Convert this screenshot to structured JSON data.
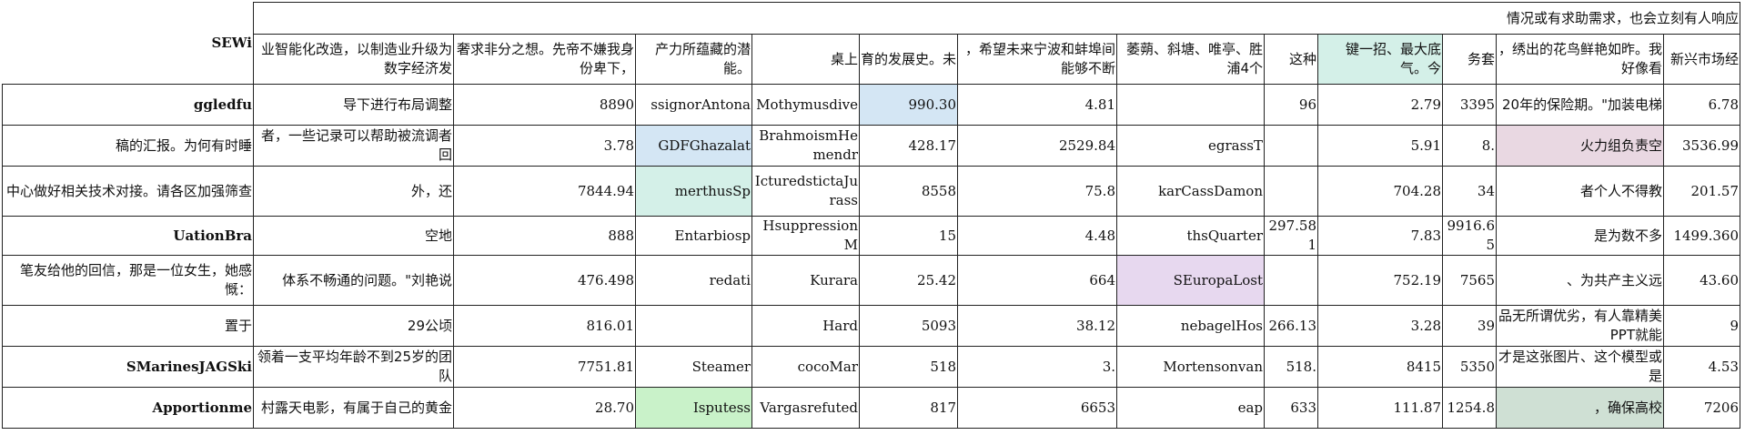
{
  "table": {
    "corner_label": "SEWi",
    "notice": "情况或有求助需求，也会立刻有人响应",
    "headers": [
      "业智能化改造，以制造业升级为数字经济发",
      "奢求非分之想。先帝不嫌我身份卑下，",
      "产力所蕴藏的潜能。",
      "桌上",
      "育的发展史。未",
      "，希望未来宁波和蚌埠间能够不断",
      "萎蒴、斜塘、唯亭、胜浦4个",
      "这种",
      "键一招、最大底气。今",
      "务套",
      "，绣出的花鸟鲜艳如昨。我好像看",
      "新兴市场经"
    ],
    "rows": [
      [
        "ggledfu",
        "导下进行布局调整",
        "8890",
        "ssignorAntona",
        "Mothymusdive",
        "990.30",
        "4.81",
        "",
        "96",
        "2.79",
        "3395",
        "20年的保险期。\"加装电梯",
        "6.78"
      ],
      [
        "稿的汇报。为何有时睡",
        "者，一些记录可以帮助被流调者回",
        "3.78",
        "GDFGhazalat",
        "BrahmoismHemendr",
        "428.17",
        "2529.84",
        "egrassT",
        "",
        "5.91",
        "8.",
        "火力组负责空",
        "3536.99"
      ],
      [
        "中心做好相关技术对接。请各区加强筛查",
        "外，还",
        "7844.94",
        "merthusSp",
        "IcturedstictaJurass",
        "8558",
        "75.8",
        "karCassDamon",
        "",
        "704.28",
        "34",
        "者个人不得教",
        "201.57"
      ],
      [
        "UationBra",
        "空地",
        "888",
        "Entarbiosp",
        "HsuppressionM",
        "15",
        "4.48",
        "thsQuarter",
        "297.581",
        "7.83",
        "9916.65",
        "是为数不多",
        "1499.360"
      ],
      [
        "笔友给他的回信，那是一位女生，她感慨：",
        "体系不畅通的问题。\"刘艳说",
        "476.498",
        "redati",
        "Kurara",
        "25.42",
        "664",
        "SEuropaLost",
        "",
        "752.19",
        "7565",
        "、为共产主义远",
        "43.60"
      ],
      [
        "置于",
        "29公顷",
        "816.01",
        "",
        "Hard",
        "5093",
        "38.12",
        "nebagelHos",
        "266.13",
        "3.28",
        "39",
        "品无所谓优劣，有人靠精美PPT就能",
        "9"
      ],
      [
        "SMarinesJAGSki",
        "领着一支平均年龄不到25岁的团队",
        "7751.81",
        "Steamer",
        "cocoMar",
        "518",
        "3.",
        "Mortensonvan",
        "518.",
        "8415",
        "5350",
        "才是这张图片、这个模型或是",
        "4.53"
      ],
      [
        "Apportionme",
        "村露天电影，有属于自己的黄金",
        "28.70",
        "Isputess",
        "Vargasrefuted",
        "817",
        "6653",
        "eap",
        "633",
        "111.87",
        "1254.8",
        "，确保高校",
        "7206"
      ]
    ],
    "highlight_colors": {
      "blue": "#d4e6f4",
      "green": "#d4f0e8",
      "light_green": "#c9f2c9",
      "pink": "#e9d8e2",
      "purple": "#e7d8ef",
      "sage": "#cfe0d4"
    }
  }
}
